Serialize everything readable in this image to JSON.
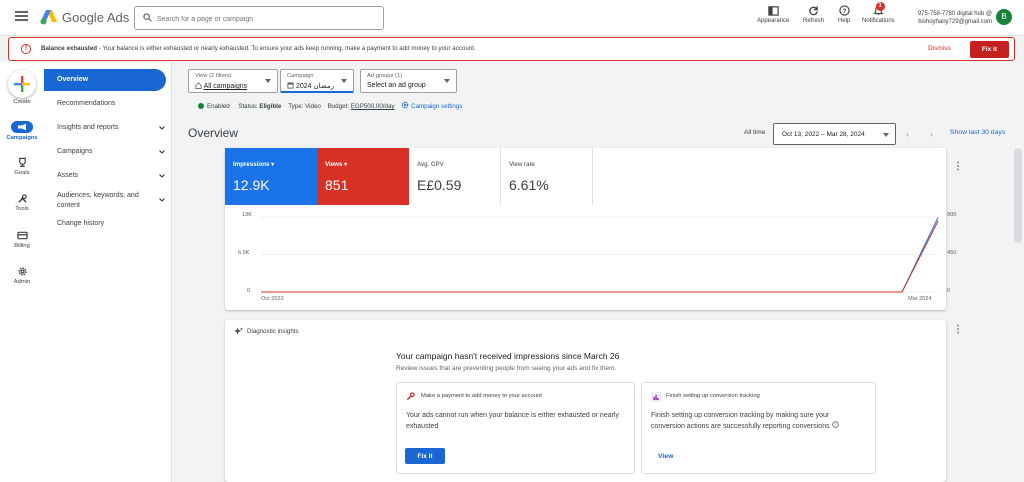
{
  "header": {
    "brand": "Google Ads",
    "search_placeholder": "Search for a page or campaign",
    "tools": [
      {
        "label": "Appearance"
      },
      {
        "label": "Refresh"
      },
      {
        "label": "Help"
      },
      {
        "label": "Notifications",
        "badge": "1"
      }
    ],
    "account_line1": "975-758-7780 digital hub @",
    "account_line2": "bishoyhany729@gmail.com",
    "avatar_letter": "B"
  },
  "alert": {
    "icon": "!",
    "bold": "Balance exhausted",
    "text": " - Your balance is either exhausted or nearly exhausted. To ensure your ads keep running, make a payment to add money to your account.",
    "dismiss": "Dismiss",
    "fix": "Fix it"
  },
  "rail": {
    "create": "Create",
    "campaigns": "Campaigns",
    "goals": "Goals",
    "tools": "Tools",
    "billing": "Billing",
    "admin": "Admin"
  },
  "sidenav": {
    "items": [
      {
        "label": "Overview"
      },
      {
        "label": "Recommendations"
      },
      {
        "label": "Insights and reports"
      },
      {
        "label": "Campaigns"
      },
      {
        "label": "Assets"
      },
      {
        "label": "Audiences, keywords, and"
      },
      {
        "label": "content"
      },
      {
        "label": "Change history"
      }
    ]
  },
  "filters": {
    "view_label": "View (2 filters)",
    "view_value": "All campaigns",
    "campaign_label": "Campaign",
    "campaign_value": "رمضان 2024",
    "adgroup_label": "Ad groups (1)",
    "adgroup_value": "Select an ad group"
  },
  "status": {
    "enabled": "Enabled",
    "status_label": "Status:",
    "status_value": "Eligible",
    "type_label": "Type:",
    "type_value": "Video",
    "budget_label": "Budget:",
    "budget_value": "EGP500.00/day",
    "settings_link": "Campaign settings"
  },
  "overview": {
    "title": "Overview",
    "all_time": "All time",
    "date_range": "Oct 13, 2022 – Mar 28, 2024",
    "show_last": "Show last 30 days"
  },
  "metrics": [
    {
      "label": "Impressions",
      "value": "12.9K",
      "color": "#1a73e8"
    },
    {
      "label": "Views",
      "value": "851",
      "color": "#d93025"
    },
    {
      "label": "Avg. CPV",
      "value": "E£0.59",
      "color": "#ffffff"
    },
    {
      "label": "View rate",
      "value": "6.61%",
      "color": "#ffffff"
    }
  ],
  "chart_data": {
    "type": "line",
    "x": [
      "Oct 2022",
      "Mar 2024"
    ],
    "y_left_ticks": [
      "13K",
      "6.5K",
      "0"
    ],
    "y_right_ticks": [
      "900",
      "450",
      "0"
    ],
    "series": [
      {
        "name": "Impressions",
        "color": "#1a73e8",
        "values": [
          0,
          12900
        ]
      },
      {
        "name": "Views",
        "color": "#d93025",
        "values": [
          0,
          851
        ]
      }
    ]
  },
  "diagnostic": {
    "title": "Diagnostic insights",
    "headline": "Your campaign hasn't received impressions since March 26",
    "sub": "Review issues that are preventing people from seeing your ads and fix them.",
    "card1_title": "Make a payment to add money to your account",
    "card1_body": "Your ads cannot run when your balance is either exhausted or nearly exhausted",
    "card1_button": "Fix it",
    "card2_title": "Finish setting up conversion tracking",
    "card2_body": "Finish setting up conversion tracking by making sure your conversion actions are successfully reporting conversions",
    "card2_link": "View"
  }
}
